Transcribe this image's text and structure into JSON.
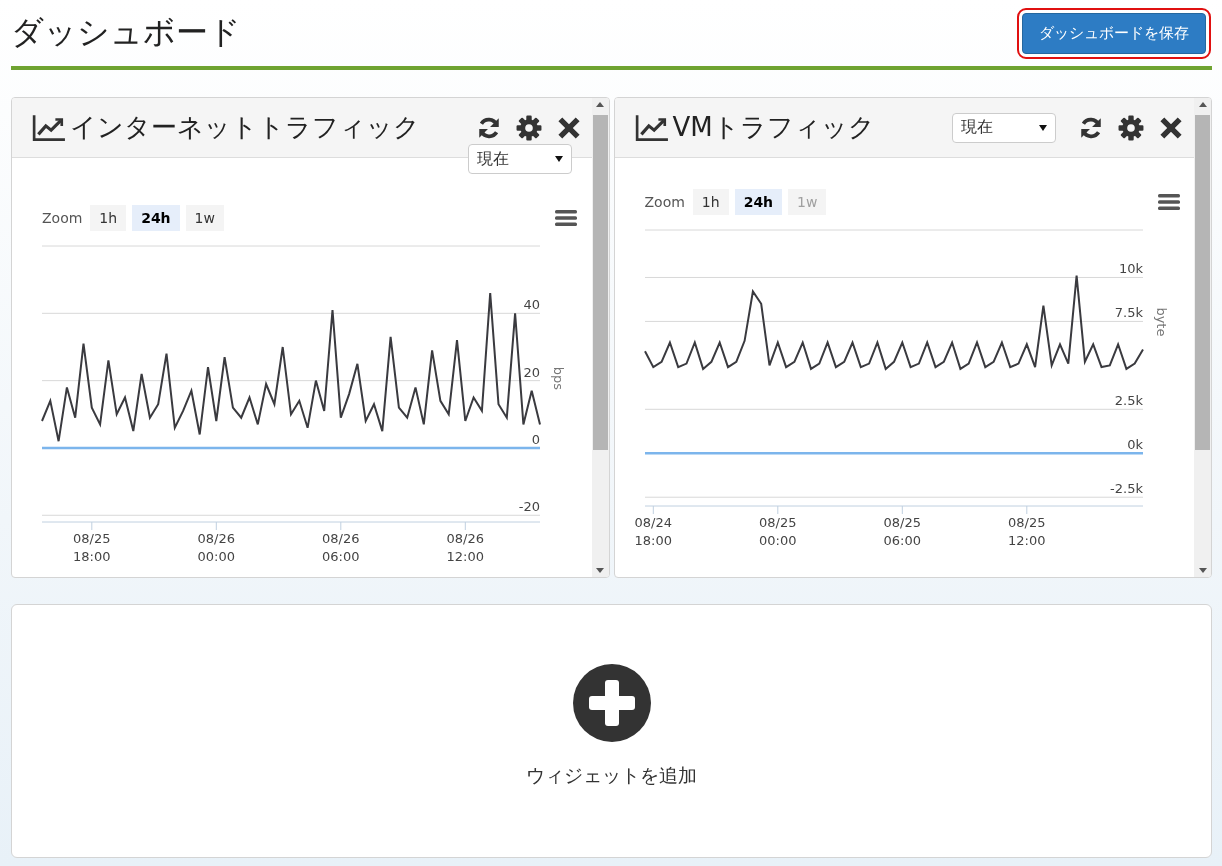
{
  "page": {
    "title": "ダッシュボード",
    "save_button": "ダッシュボードを保存"
  },
  "widgets": [
    {
      "title": "インターネットトラフィック",
      "period_select": "現在",
      "zoom_label": "Zoom",
      "zoom_buttons": [
        {
          "label": "1h",
          "selected": false,
          "disabled": false
        },
        {
          "label": "24h",
          "selected": true,
          "disabled": false
        },
        {
          "label": "1w",
          "selected": false,
          "disabled": false
        }
      ],
      "chart_data": {
        "type": "line",
        "ylabel": "bps",
        "grid": true,
        "ylim": [
          -22,
          60
        ],
        "yticks": [
          40,
          20,
          0,
          -20
        ],
        "categories": [
          null,
          null,
          null,
          null,
          null,
          null,
          "08/25 18:00",
          null,
          null,
          null,
          null,
          null,
          null,
          null,
          null,
          null,
          null,
          null,
          null,
          null,
          null,
          "08/26 00:00",
          null,
          null,
          null,
          null,
          null,
          null,
          null,
          null,
          null,
          null,
          null,
          null,
          null,
          null,
          "08/26 06:00",
          null,
          null,
          null,
          null,
          null,
          null,
          null,
          null,
          null,
          null,
          null,
          null,
          null,
          null,
          "08/26 12:00",
          null,
          null,
          null,
          null,
          null,
          null,
          null,
          null,
          null
        ],
        "series": [
          {
            "color": "#3a3a3f",
            "values": [
              8,
              14,
              2,
              18,
              9,
              31,
              12,
              7,
              26,
              10,
              15,
              5,
              22,
              9,
              13,
              28,
              6,
              11,
              17,
              4,
              24,
              8,
              27,
              12,
              9,
              15,
              7,
              19,
              13,
              30,
              10,
              14,
              6,
              20,
              11,
              41,
              9,
              16,
              25,
              8,
              13,
              5,
              33,
              12,
              9,
              18,
              7,
              29,
              14,
              10,
              32,
              8,
              15,
              11,
              46,
              13,
              9,
              40,
              7,
              17,
              7
            ]
          },
          {
            "color": "#7cb5ec",
            "values": [
              0,
              0,
              0,
              0,
              0,
              0,
              0,
              0,
              0,
              0,
              0,
              0,
              0,
              0,
              0,
              0,
              0,
              0,
              0,
              0,
              0,
              0,
              0,
              0,
              0,
              0,
              0,
              0,
              0,
              0,
              0,
              0,
              0,
              0,
              0,
              0,
              0,
              0,
              0,
              0,
              0,
              0,
              0,
              0,
              0,
              0,
              0,
              0,
              0,
              0,
              0,
              0,
              0,
              0,
              0,
              0,
              0,
              0,
              0,
              0,
              0
            ]
          }
        ]
      }
    },
    {
      "title": "VMトラフィック",
      "period_select": "現在",
      "zoom_label": "Zoom",
      "zoom_buttons": [
        {
          "label": "1h",
          "selected": false,
          "disabled": false
        },
        {
          "label": "24h",
          "selected": true,
          "disabled": false
        },
        {
          "label": "1w",
          "selected": false,
          "disabled": true
        }
      ],
      "chart_data": {
        "type": "line",
        "ylabel": "byte",
        "grid": true,
        "ylim": [
          -3000,
          12700
        ],
        "yticks": [
          {
            "value": 10000,
            "label": "10k"
          },
          {
            "value": 7500,
            "label": "7.5k"
          },
          {
            "value": 2500,
            "label": "2.5k"
          },
          {
            "value": 0,
            "label": "0k"
          },
          {
            "value": -2500,
            "label": "-2.5k"
          }
        ],
        "categories": [
          null,
          "08/24 18:00",
          null,
          null,
          null,
          null,
          null,
          null,
          null,
          null,
          null,
          null,
          null,
          null,
          null,
          null,
          "08/25 00:00",
          null,
          null,
          null,
          null,
          null,
          null,
          null,
          null,
          null,
          null,
          null,
          null,
          null,
          null,
          "08/25 06:00",
          null,
          null,
          null,
          null,
          null,
          null,
          null,
          null,
          null,
          null,
          null,
          null,
          null,
          null,
          "08/25 12:00",
          null,
          null,
          null,
          null,
          null,
          null,
          null,
          null,
          null,
          null,
          null,
          null,
          null,
          null
        ],
        "series": [
          {
            "color": "#3a3a3f",
            "values": [
              5800,
              4900,
              5200,
              6300,
              4900,
              5100,
              6300,
              4800,
              5200,
              6300,
              4900,
              5200,
              6400,
              9200,
              8500,
              5000,
              6300,
              4900,
              5200,
              6300,
              4800,
              5100,
              6300,
              4900,
              5200,
              6300,
              4900,
              5100,
              6300,
              4800,
              5200,
              6300,
              4900,
              5100,
              6300,
              4900,
              5200,
              6300,
              4800,
              5100,
              6300,
              4900,
              5200,
              6300,
              4900,
              5100,
              6200,
              4900,
              8400,
              5000,
              6200,
              5100,
              10100,
              5200,
              6200,
              4900,
              5000,
              6200,
              4800,
              5100,
              5900
            ]
          },
          {
            "color": "#7cb5ec",
            "values": [
              0,
              0,
              0,
              0,
              0,
              0,
              0,
              0,
              0,
              0,
              0,
              0,
              0,
              0,
              0,
              0,
              0,
              0,
              0,
              0,
              0,
              0,
              0,
              0,
              0,
              0,
              0,
              0,
              0,
              0,
              0,
              0,
              0,
              0,
              0,
              0,
              0,
              0,
              0,
              0,
              0,
              0,
              0,
              0,
              0,
              0,
              0,
              0,
              0,
              0,
              0,
              0,
              0,
              0,
              0,
              0,
              0,
              0,
              0,
              0,
              0
            ]
          }
        ]
      }
    }
  ],
  "add_widget": {
    "label": "ウィジェットを追加"
  }
}
